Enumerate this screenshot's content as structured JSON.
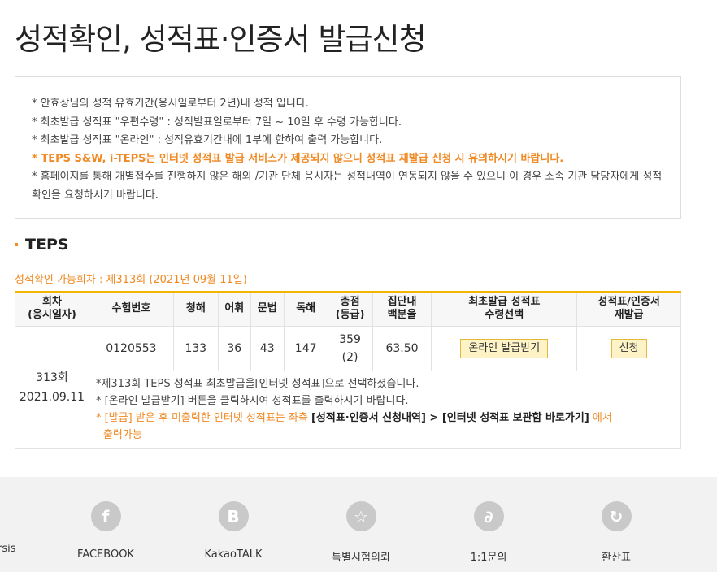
{
  "page_title": "성적확인, 성적표·인증서 발급신청",
  "notices": [
    "* 안효상님의 성적 유효기간(응시일로부터 2년)내 성적 입니다.",
    "* 최초발급 성적표 \"우편수령\" : 성적발표일로부터 7일 ~ 10일 후 수령 가능합니다.",
    "* 최초발급 성적표 \"온라인\" : 성적유효기간내에 1부에 한하여 출력 가능합니다.",
    "* TEPS S&W, i-TEPS는 인터넷 성적표 발급 서비스가 제공되지 않으니 성적표 재발급 신청 시 유의하시기 바랍니다.",
    "* 홈페이지를 통해 개별접수를 진행하지 않은 해외 /기관 단체 응시자는 성적내역이 연동되지 않을 수 있으니 이 경우 소속 기관 담당자에게 성적확인을 요청하시기 바랍니다."
  ],
  "section_title": "TEPS",
  "available_rounds": "성적확인 가능회차 : 제313회 (2021년 09월 11일)",
  "table": {
    "headers": {
      "round": [
        "회차",
        "(응시일자)"
      ],
      "exam_no": "수험번호",
      "listening": "청해",
      "vocab": "어휘",
      "grammar": "문법",
      "reading": "독해",
      "total": [
        "총점",
        "(등급)"
      ],
      "percentile": [
        "집단내",
        "백분율"
      ],
      "first_issue": [
        "최초발급 성적표",
        "수령선택"
      ],
      "reissue": [
        "성적표/인증서",
        "재발급"
      ]
    },
    "row": {
      "round": "313회",
      "date": "2021.09.11",
      "exam_no": "0120553",
      "listening": "133",
      "vocab": "36",
      "grammar": "43",
      "reading": "147",
      "total": "359",
      "grade": "(2)",
      "percentile": "63.50",
      "online_button": "온라인 발급받기",
      "reissue_button": "신청"
    },
    "messages": {
      "line1": "*제313회 TEPS 성적표 최초발급을[인터넷 성적표]으로 선택하셨습니다.",
      "line2": "* [온라인 발급받기] 버튼을 클릭하시여 성적표를 출력하시기 바랍니다.",
      "line3_prefix": "* [발급] 받은 후 미출력한 인터넷 성적표는 좌측 ",
      "line3_bold": "[성적표·인증서 신청내역] > [인터넷 성적표 보관함 바로가기]",
      "line3_suffix": " 에서",
      "line4": "출력가능"
    }
  },
  "footer": {
    "partial_label": "rsis",
    "items": [
      {
        "label": "FACEBOOK",
        "icon": "facebook-icon",
        "glyph": "f"
      },
      {
        "label": "KakaoTALK",
        "icon": "kakaotalk-icon",
        "glyph": "B"
      },
      {
        "label": "특별시험의뢰",
        "icon": "star-icon",
        "glyph": "☆"
      },
      {
        "label": "1:1문의",
        "icon": "chat-icon",
        "glyph": "∂"
      },
      {
        "label": "환산표",
        "icon": "refresh-icon",
        "glyph": "↻"
      }
    ]
  },
  "colors": {
    "accent_orange": "#f08a24",
    "table_top_border": "#f4b400",
    "button_bg": "#fdf3c7",
    "footer_bg": "#f2f2f2",
    "footer_icon": "#c9c9c9"
  }
}
